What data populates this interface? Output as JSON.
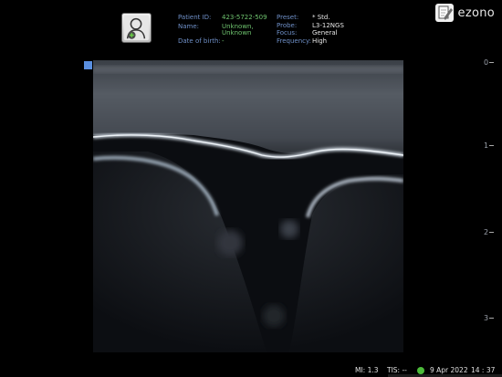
{
  "patient_info": {
    "labels": [
      "Patient ID:",
      "Name:",
      "",
      "Date of birth:"
    ],
    "values": [
      "423-5722-509",
      "Unknown,",
      "Unknown",
      "-"
    ]
  },
  "acquisition": {
    "labels": [
      "Preset:",
      "Probe:",
      "Focus:",
      "Frequency:"
    ],
    "values": [
      "* Std.",
      "L3-12NGS",
      "General",
      "High"
    ]
  },
  "brand": {
    "name": "ezono",
    "icon": "edit-icon"
  },
  "depth_scale": [
    "0",
    "1",
    "2",
    "3"
  ],
  "status": {
    "mi": "MI: 1.3",
    "tis": "TIS: --",
    "date": "9 Apr 2022",
    "time": "14 : 37"
  },
  "colors": {
    "label": "#6f90c8",
    "value": "#6fc46f",
    "roi_marker": "#5a8fe0"
  }
}
